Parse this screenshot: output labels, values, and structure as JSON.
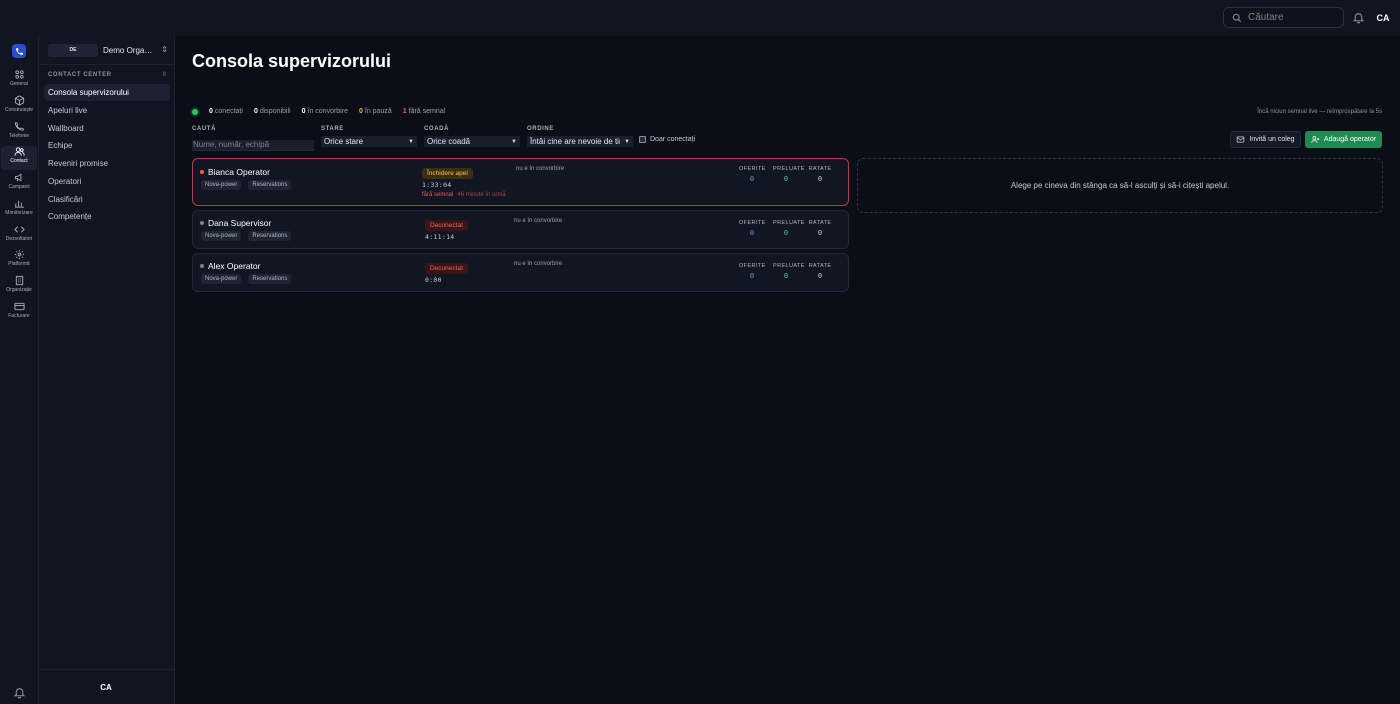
{
  "topbar": {
    "search_placeholder": "Căutare",
    "avatar_initials": "CA"
  },
  "colors": {
    "brand": "#2d4cc8",
    "accent_green": "#1f8a52",
    "danger": "#ef5a5a",
    "warning": "#f0c24b",
    "avatar": "#0b0e17"
  },
  "rail": {
    "items": [
      {
        "label": "General",
        "icon": "grid-icon"
      },
      {
        "label": "Construiește",
        "icon": "cube-icon"
      },
      {
        "label": "Telefonie",
        "icon": "phone-icon"
      },
      {
        "label": "Contact",
        "icon": "users-icon",
        "active": true
      },
      {
        "label": "Campanii",
        "icon": "megaphone-icon"
      },
      {
        "label": "Monitorizare",
        "icon": "bar-chart-icon"
      },
      {
        "label": "Dezvoltatori",
        "icon": "code-icon"
      },
      {
        "label": "Platformă",
        "icon": "gear-icon"
      },
      {
        "label": "Organizație",
        "icon": "building-icon"
      },
      {
        "label": "Facturare",
        "icon": "credit-card-icon"
      }
    ]
  },
  "sidebar": {
    "org_badge": "DE",
    "org_name": "Demo Organization",
    "section_label": "CONTACT CENTER",
    "section_count": "8",
    "items": [
      {
        "label": "Consola supervizorului",
        "active": true
      },
      {
        "label": "Apeluri live"
      },
      {
        "label": "Wallboard"
      },
      {
        "label": "Echipe"
      },
      {
        "label": "Reveniri promise"
      },
      {
        "label": "Operatori"
      },
      {
        "label": "Clasificări"
      },
      {
        "label": "Competențe"
      }
    ],
    "avatar_initials": "CA"
  },
  "main": {
    "title": "Consola supervizorului",
    "stats": [
      {
        "value": "0",
        "label": "conectați"
      },
      {
        "value": "0",
        "label": "disponibili"
      },
      {
        "value": "0",
        "label": "în convorbire"
      },
      {
        "value": "0",
        "label": "în pauză"
      },
      {
        "value": "1",
        "label": "fără semnal"
      }
    ],
    "live_note": "Încă niciun semnal live — reîmprospătare la 5s",
    "filters": {
      "search_label": "CAUTĂ",
      "search_placeholder": "Nume, număr, echipă",
      "state_label": "STARE",
      "state_value": "Orice stare",
      "queue_label": "COADĂ",
      "queue_value": "Orice coadă",
      "order_label": "ORDINE",
      "order_value": "Întâi cine are nevoie de timp",
      "only_connected_label": "Doar conectați"
    },
    "invite_button": "Invită un coleg",
    "add_button": "Adaugă operator",
    "metric_labels": {
      "offered": "OFERITE",
      "taken": "PRELUATE",
      "missed": "RATATE"
    },
    "operators": [
      {
        "name": "Bianca Operator",
        "tags": [
          "Nova-power",
          "Reservations"
        ],
        "state": "Închidere apel",
        "timer": "1:33:04",
        "signal": "fără semnal",
        "signal_ago": "46 minute în urmă",
        "conversation": "nu e în convorbire",
        "offered": "0",
        "taken": "0",
        "missed": "0"
      },
      {
        "name": "Dana Supervisor",
        "tags": [
          "Nova-power",
          "Reservations"
        ],
        "state": "Deconectat",
        "timer": "4:11:14",
        "conversation": "nu e în convorbire",
        "offered": "0",
        "taken": "0",
        "missed": "0"
      },
      {
        "name": "Alex Operator",
        "tags": [
          "Nova-power",
          "Reservations"
        ],
        "state": "Deconectat",
        "timer": "0:00",
        "conversation": "nu e în convorbire",
        "offered": "0",
        "taken": "0",
        "missed": "0"
      }
    ],
    "detail_placeholder": "Alege pe cineva din stânga ca să-l asculți și să-i citești apelul."
  }
}
